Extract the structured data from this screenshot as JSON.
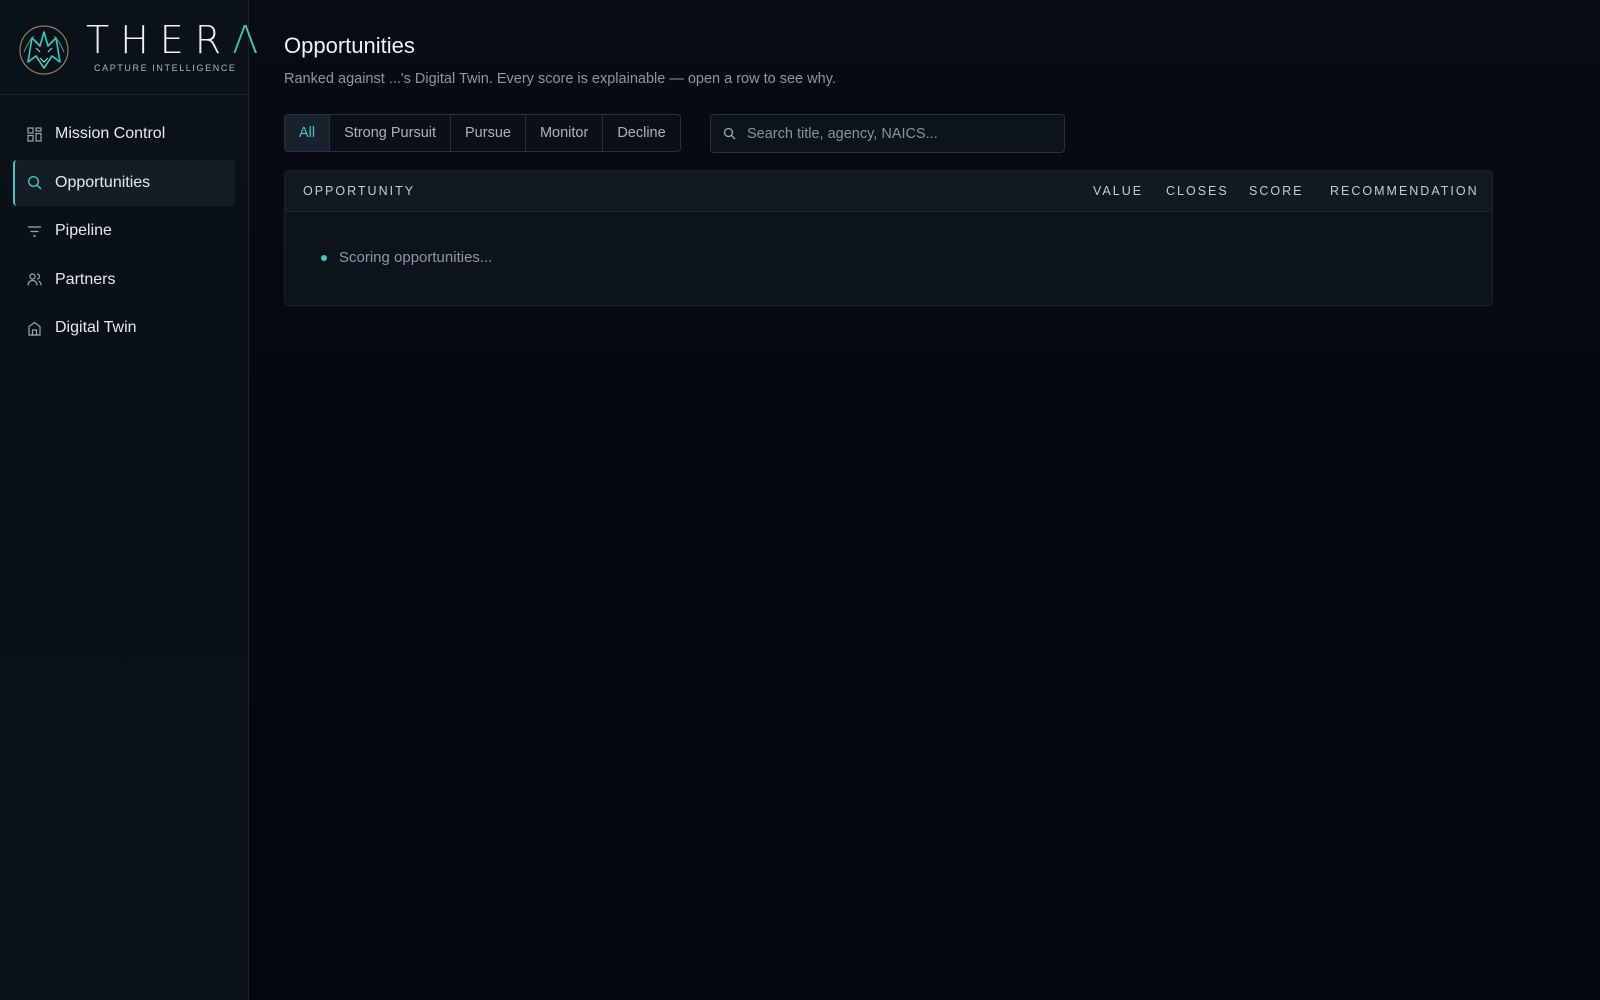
{
  "brand": {
    "name_main": "THER",
    "name_accent": "Λ",
    "tagline": "CAPTURE INTELLIGENCE",
    "logo_icon": "wolf-head-icon",
    "accent_color": "#3ec9bd"
  },
  "sidebar": {
    "items": [
      {
        "label": "Mission Control",
        "icon": "grid-icon",
        "active": false
      },
      {
        "label": "Opportunities",
        "icon": "search-icon",
        "active": true
      },
      {
        "label": "Pipeline",
        "icon": "filter-icon",
        "active": false
      },
      {
        "label": "Partners",
        "icon": "users-icon",
        "active": false
      },
      {
        "label": "Digital Twin",
        "icon": "building-icon",
        "active": false
      }
    ]
  },
  "page": {
    "title": "Opportunities",
    "subtitle": "Ranked against ...'s Digital Twin. Every score is explainable — open a row to see why."
  },
  "filters": {
    "options": [
      "All",
      "Strong Pursuit",
      "Pursue",
      "Monitor",
      "Decline"
    ],
    "selected": "All"
  },
  "search": {
    "placeholder": "Search title, agency, NAICS...",
    "value": ""
  },
  "table": {
    "columns": [
      "OPPORTUNITY",
      "VALUE",
      "CLOSES",
      "SCORE",
      "RECOMMENDATION"
    ],
    "rows": [],
    "loading_text": "Scoring opportunities..."
  }
}
